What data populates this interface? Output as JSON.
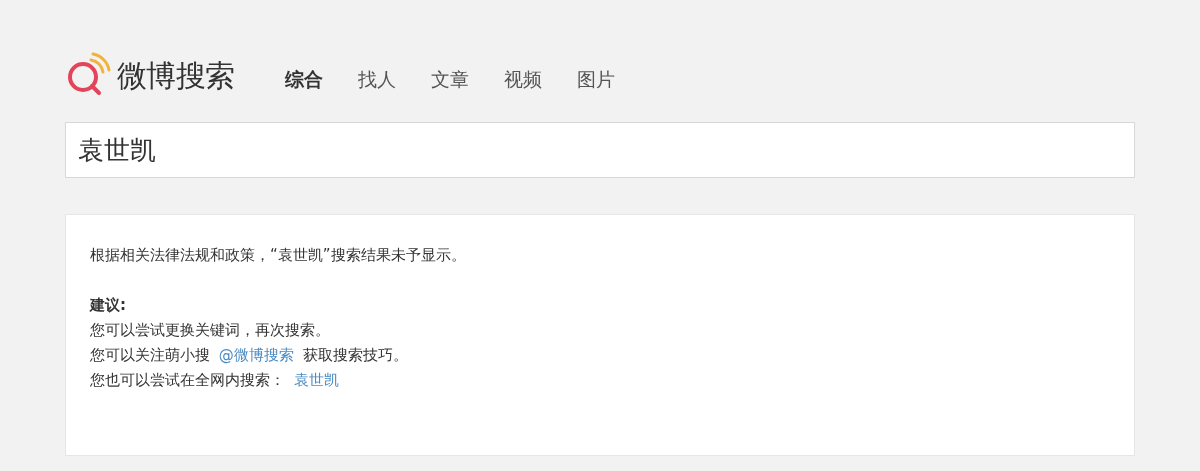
{
  "logo": {
    "text": "微博搜索"
  },
  "tabs": [
    {
      "label": "综合",
      "selected": true
    },
    {
      "label": "找人",
      "selected": false
    },
    {
      "label": "文章",
      "selected": false
    },
    {
      "label": "视频",
      "selected": false
    },
    {
      "label": "图片",
      "selected": false
    }
  ],
  "search": {
    "value": "袁世凯"
  },
  "notice": {
    "message": "根据相关法律法规和政策，“袁世凯”搜索结果未予显示。",
    "suggestion_title": "建议:",
    "suggestions": [
      {
        "text": "您可以尝试更换关键词，再次搜索。"
      },
      {
        "text": "您可以关注萌小搜",
        "link": "@微博搜索",
        "after": "获取搜索技巧。"
      },
      {
        "text": "您也可以尝试在全网内搜索：",
        "link": "袁世凯"
      }
    ]
  }
}
